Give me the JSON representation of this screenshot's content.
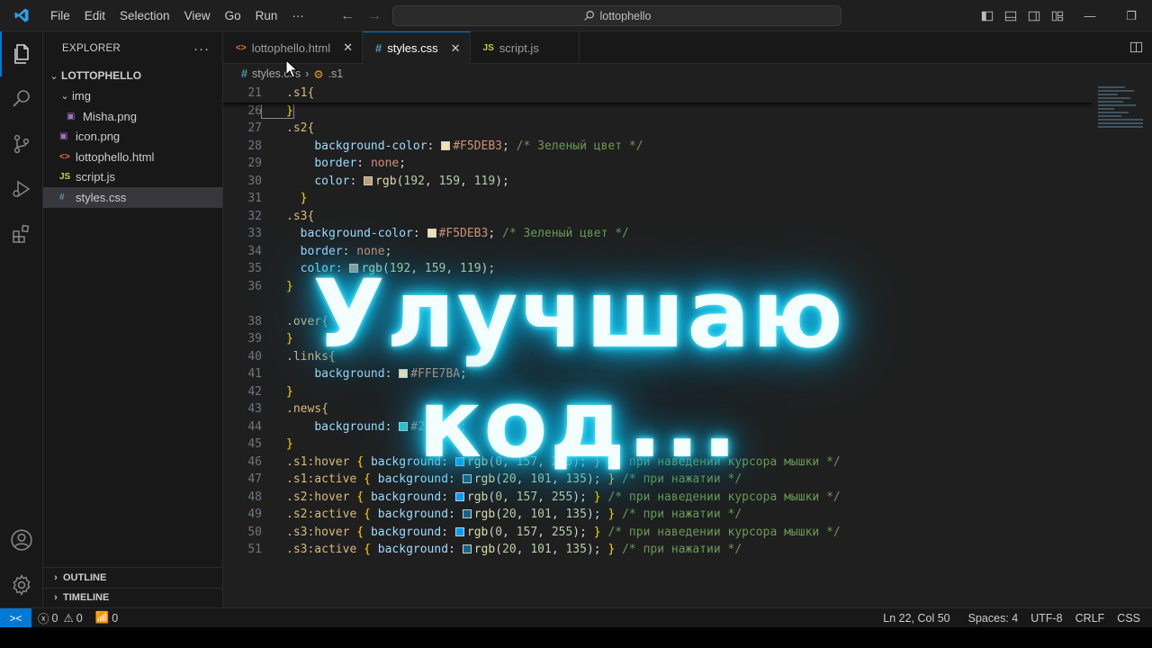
{
  "menu": [
    "File",
    "Edit",
    "Selection",
    "View",
    "Go",
    "Run"
  ],
  "search": {
    "text": "lottophello"
  },
  "sidebar": {
    "title": "EXPLORER",
    "project": "LOTTOPHELLO",
    "items": [
      {
        "label": "img",
        "type": "folder"
      },
      {
        "label": "Misha.png",
        "type": "image"
      },
      {
        "label": "icon.png",
        "type": "image"
      },
      {
        "label": "lottophello.html",
        "type": "html"
      },
      {
        "label": "script.js",
        "type": "js"
      },
      {
        "label": "styles.css",
        "type": "css"
      }
    ],
    "outline": "OUTLINE",
    "timeline": "TIMELINE"
  },
  "tabs": [
    {
      "label": "lottophello.html",
      "icon": "<>"
    },
    {
      "label": "styles.css",
      "icon": "#"
    },
    {
      "label": "script.js",
      "icon": "JS"
    }
  ],
  "breadcrumb": {
    "file": "styles.css",
    "symbol": ".s1"
  },
  "code": {
    "l21": {
      "n": "21",
      "t": ".s1{"
    },
    "l26": {
      "n": "26",
      "t": "}"
    },
    "l27": {
      "n": "27",
      "t": ".s2{"
    },
    "l28": {
      "n": "28",
      "p": "background-color",
      "v": "#F5DEB3",
      "c": "/* Зеленый цвет */"
    },
    "l29": {
      "n": "29",
      "p": "border",
      "v": "none"
    },
    "l30": {
      "n": "30",
      "p": "color",
      "a": "192",
      "b": "159",
      "d": "119"
    },
    "l31": {
      "n": "31",
      "t": "}"
    },
    "l32": {
      "n": "32",
      "t": ".s3{"
    },
    "l33": {
      "n": "33",
      "p": "background-color",
      "v": "#F5DEB3",
      "c": "/* Зеленый цвет */"
    },
    "l34": {
      "n": "34",
      "p": "border",
      "v": "none"
    },
    "l35": {
      "n": "35",
      "p": "color",
      "a": "192",
      "b": "159",
      "d": "119"
    },
    "l36": {
      "n": "36",
      "t": "}"
    },
    "l38": {
      "n": "38",
      "t": ".over{"
    },
    "l39": {
      "n": "39",
      "t": "}"
    },
    "l40": {
      "n": "40",
      "t": ".links{"
    },
    "l41": {
      "n": "41",
      "p": "background",
      "v": "#FFE7BA"
    },
    "l42": {
      "n": "42",
      "t": "}"
    },
    "l43": {
      "n": "43",
      "t": ".news{"
    },
    "l44": {
      "n": "44",
      "p": "background",
      "v": "#23d0d3"
    },
    "l45": {
      "n": "45",
      "t": "}"
    },
    "l46": {
      "n": "46",
      "s": ".s1:hover",
      "p": "background",
      "a": "0",
      "b": "157",
      "d": "255",
      "c": "/* при наведении курсора мышки */"
    },
    "l47": {
      "n": "47",
      "s": ".s1:active",
      "p": "background",
      "a": "20",
      "b": "101",
      "d": "135",
      "c": "/* при нажатии */"
    },
    "l48": {
      "n": "48",
      "s": ".s2:hover",
      "p": "background",
      "a": "0",
      "b": "157",
      "d": "255",
      "c": "/* при наведении курсора мышки */"
    },
    "l49": {
      "n": "49",
      "s": ".s2:active",
      "p": "background",
      "a": "20",
      "b": "101",
      "d": "135",
      "c": "/* при нажатии */"
    },
    "l50": {
      "n": "50",
      "s": ".s3:hover",
      "p": "background",
      "a": "0",
      "b": "157",
      "d": "255",
      "c": "/* при наведении курсора мышки */"
    },
    "l51": {
      "n": "51",
      "s": ".s3:active",
      "p": "background",
      "a": "20",
      "b": "101",
      "d": "135",
      "c": "/* при нажатии */"
    }
  },
  "overlay": "Улучшаю код...",
  "status": {
    "errors": "0",
    "warnings": "0",
    "ports": "0",
    "position": "Ln 22, Col 50",
    "spaces": "Spaces: 4",
    "encoding": "UTF-8",
    "eol": "CRLF",
    "language": "CSS"
  },
  "colors": {
    "accent": "#0078d4",
    "glow": "#21d4f5"
  }
}
